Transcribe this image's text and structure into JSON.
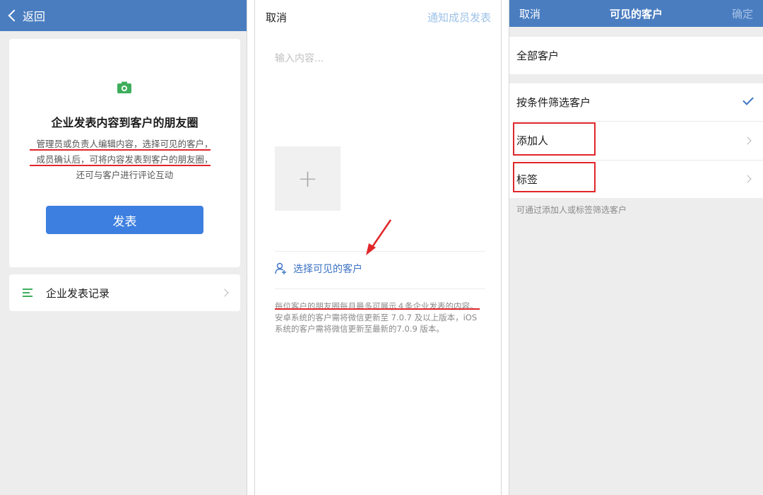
{
  "panel1": {
    "back_label": "返回",
    "headline": "企业发表内容到客户的朋友圈",
    "desc_lines": [
      "管理员或负责人编辑内容，选择可见的客户，",
      "成员确认后，可将内容发表到客户的朋友圈，",
      "还可与客户进行评论互动"
    ],
    "publish_button": "发表",
    "record_label": "企业发表记录"
  },
  "panel2": {
    "cancel": "取消",
    "notify": "通知成员发表",
    "input_placeholder": "输入内容...",
    "add_symbol": "+",
    "select_visible": "选择可见的客户",
    "note": "每位客户的朋友圈每月最多可展示４条企业发表的内容。安卓系统的客户需将微信更新至 7.0.7 及以上版本，iOS 系统的客户需将微信更新至最新的7.0.9 版本。"
  },
  "panel3": {
    "cancel": "取消",
    "title": "可见的客户",
    "confirm": "确定",
    "all_customers": "全部客户",
    "filter_customers": "按条件筛选客户",
    "adder": "添加人",
    "tag": "标签",
    "hint": "可通过添加人或标签筛选客户"
  },
  "colors": {
    "nav_blue": "#4a7dc0",
    "button_blue": "#3d7fe0",
    "link_blue": "#3b72c4",
    "annotation_red": "#e0262a",
    "camera_green": "#3eae5c"
  },
  "icons": [
    "back-chevron-icon",
    "camera-icon",
    "list-icon",
    "chevron-right-icon",
    "plus-icon",
    "add-user-icon",
    "checkmark-icon",
    "red-arrow-icon"
  ]
}
